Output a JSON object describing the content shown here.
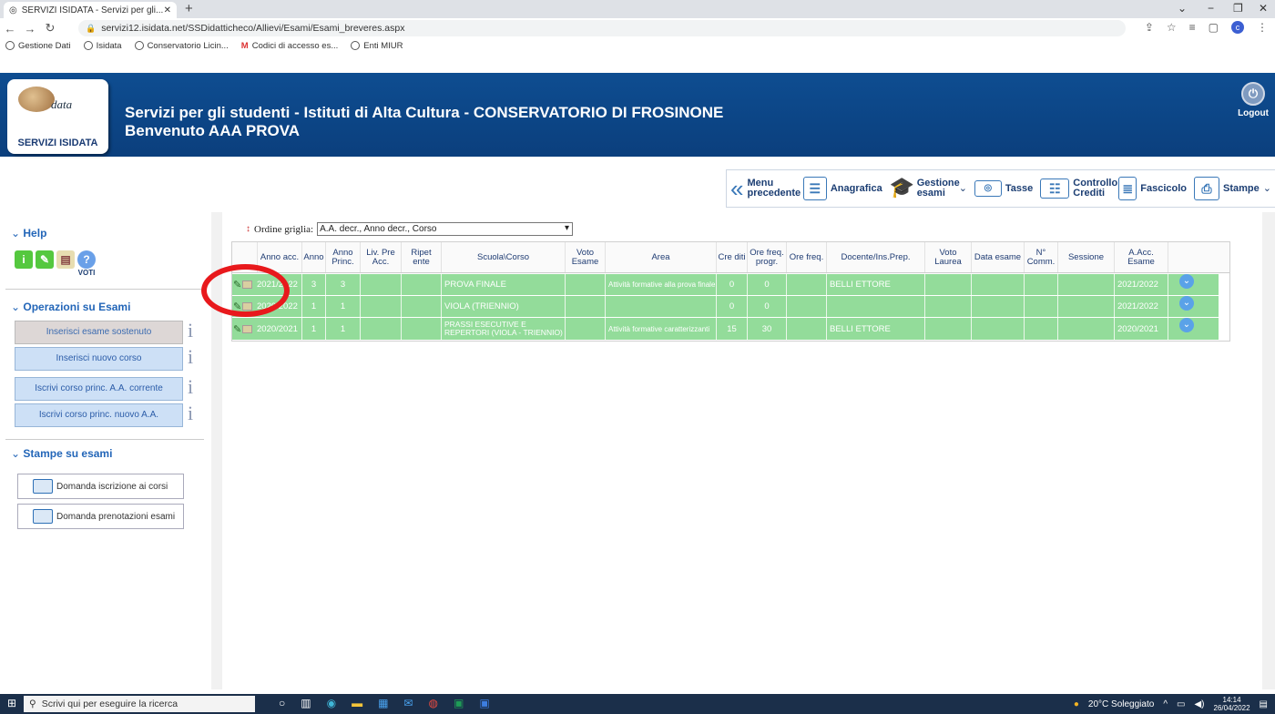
{
  "browser": {
    "tab_title": "SERVIZI ISIDATA - Servizi per gli...",
    "new_tab_icon": "+",
    "url": "servizi12.isidata.net/SSDidatticheco/Allievi/Esami/Esami_breveres.aspx",
    "bookmarks": [
      "Gestione Dati",
      "Isidata",
      "Conservatorio Licin...",
      "Codici di accesso es...",
      "Enti MIUR"
    ]
  },
  "header": {
    "logo_text": "data",
    "logo_label": "SERVIZI ISIDATA",
    "title_line1": "Servizi per gli studenti - Istituti di Alta Cultura - CONSERVATORIO DI FROSINONE",
    "title_line2": "Benvenuto AAA PROVA",
    "logout": "Logout"
  },
  "toolbar": {
    "items": [
      {
        "label": "Menu precedente"
      },
      {
        "label": "Anagrafica"
      },
      {
        "label": "Gestione esami"
      },
      {
        "label": "Tasse"
      },
      {
        "label": "Controllo Crediti"
      },
      {
        "label": "Fascicolo"
      },
      {
        "label": "Stampe"
      }
    ]
  },
  "sidebar": {
    "help_title": "Help",
    "voti_label": "VOTI",
    "ops_title": "Operazioni su Esami",
    "ops": [
      "Inserisci esame sostenuto",
      "Inserisci nuovo corso",
      "Iscrivi corso princ. A.A. corrente",
      "Iscrivi corso princ. nuovo A.A."
    ],
    "prints_title": "Stampe su esami",
    "prints": [
      "Domanda iscrizione ai corsi",
      "Domanda prenotazioni esami"
    ]
  },
  "grid": {
    "order_label": "Ordine griglia:",
    "order_value": "A.A. decr., Anno decr., Corso",
    "columns": [
      "Anno acc.",
      "Anno",
      "Anno Princ.",
      "Liv. Pre Acc.",
      "Ripet ente",
      "Scuola\\Corso",
      "Voto Esame",
      "Area",
      "Cre diti",
      "Ore freq. progr.",
      "Ore freq.",
      "Docente/Ins.Prep.",
      "Voto Laurea",
      "Data esame",
      "N° Comm.",
      "Sessione",
      "A.Acc. Esame"
    ],
    "rows": [
      {
        "anno_acc": "2021/2022",
        "anno": "3",
        "anno_princ": "3",
        "liv": "",
        "ripet": "",
        "corso": "PROVA FINALE",
        "voto": "",
        "area": "Attività formative alla prova finale",
        "crediti": "0",
        "ore_prog": "0",
        "ore_freq": "",
        "docente": "BELLI ETTORE",
        "voto_laurea": "",
        "data": "",
        "comm": "",
        "sessione": "",
        "aacc": "2021/2022"
      },
      {
        "anno_acc": "2020/2022",
        "anno": "1",
        "anno_princ": "1",
        "liv": "",
        "ripet": "",
        "corso": "VIOLA (TRIENNIO)",
        "voto": "",
        "area": "",
        "crediti": "0",
        "ore_prog": "0",
        "ore_freq": "",
        "docente": "",
        "voto_laurea": "",
        "data": "",
        "comm": "",
        "sessione": "",
        "aacc": "2021/2022"
      },
      {
        "anno_acc": "2020/2021",
        "anno": "1",
        "anno_princ": "1",
        "liv": "",
        "ripet": "",
        "corso": "PRASSI ESECUTIVE E REPERTORI (VIOLA - TRIENNIO)",
        "voto": "",
        "area": "Attività formative caratterizzanti",
        "crediti": "15",
        "ore_prog": "30",
        "ore_freq": "",
        "docente": "BELLI ETTORE",
        "voto_laurea": "",
        "data": "",
        "comm": "",
        "sessione": "",
        "aacc": "2020/2021"
      }
    ]
  },
  "taskbar": {
    "search_placeholder": "Scrivi qui per eseguire la ricerca",
    "weather": "20°C Soleggiato",
    "time": "14:14",
    "date": "26/04/2022"
  },
  "colors": {
    "header_blue": "#0e4d91",
    "row_green": "#93dc9a",
    "annotation_red": "#e8191c"
  }
}
